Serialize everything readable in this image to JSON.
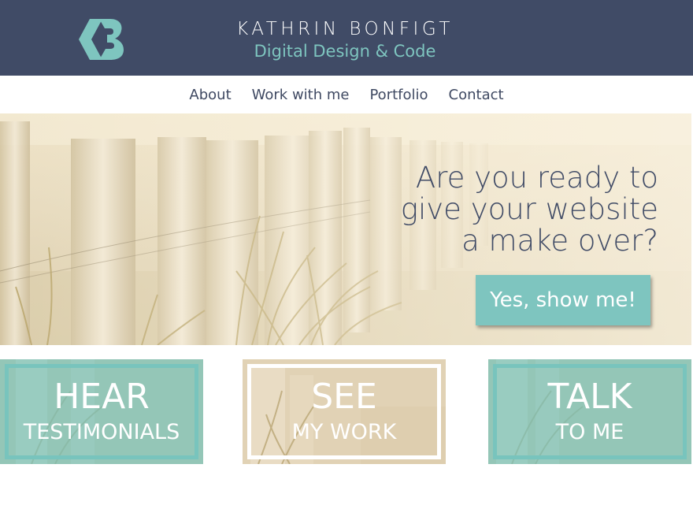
{
  "header": {
    "brand_name": "KATHRIN BONFIGT",
    "tagline": "Digital Design & Code",
    "logo_icon": "kb-logo-icon",
    "colors": {
      "background": "#404b66",
      "accent": "#7ec5bf"
    }
  },
  "nav": {
    "items": [
      {
        "label": "About"
      },
      {
        "label": "Work with me"
      },
      {
        "label": "Portfolio"
      },
      {
        "label": "Contact"
      }
    ]
  },
  "hero": {
    "heading_lines": [
      "Are you ready to",
      "give your website",
      "a make over?"
    ],
    "cta_label": "Yes, show me!",
    "background_icon": "beach-fence-photo"
  },
  "tiles": [
    {
      "title": "HEAR",
      "subtitle": "TESTIMONIALS"
    },
    {
      "title": "SEE",
      "subtitle": "MY WORK"
    },
    {
      "title": "TALK",
      "subtitle": "TO ME"
    }
  ]
}
